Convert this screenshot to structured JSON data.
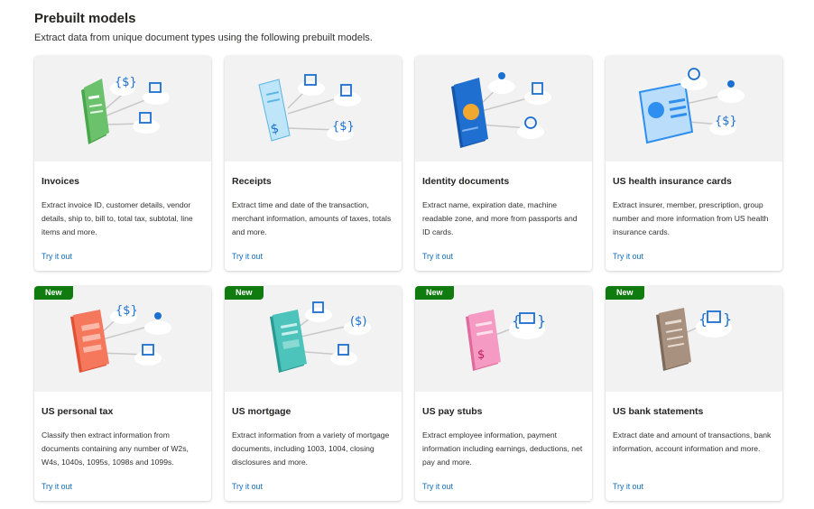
{
  "header": {
    "title": "Prebuilt models",
    "subtitle": "Extract data from unique document types using the following prebuilt models."
  },
  "badge_label": "New",
  "colors": {
    "link": "#0f6cbd",
    "badge": "#107c10",
    "card_image_bg": "#f2f2f2",
    "invoice": "#5bb85b",
    "receipt": "#a8dcf5",
    "identity": "#1a6fd1",
    "health": "#2f8ff0",
    "tax": "#f0674a",
    "mortgage": "#3cb8b0",
    "paystub": "#f088b4",
    "bank": "#9a8676"
  },
  "cards": [
    {
      "title": "Invoices",
      "description": "Extract invoice ID, customer details, vendor details, ship to, bill to, total tax, subtotal, line items and more.",
      "link": "Try it out",
      "icon": "invoice-document-icon",
      "is_new": false
    },
    {
      "title": "Receipts",
      "description": "Extract time and date of the transaction, merchant information, amounts of taxes, totals and more.",
      "link": "Try it out",
      "icon": "receipt-document-icon",
      "is_new": false
    },
    {
      "title": "Identity documents",
      "description": "Extract name, expiration date, machine readable zone, and more from passports and ID cards.",
      "link": "Try it out",
      "icon": "passport-icon",
      "is_new": false
    },
    {
      "title": "US health insurance cards",
      "description": "Extract insurer, member, prescription, group number and more information from US health insurance cards.",
      "link": "Try it out",
      "icon": "health-card-icon",
      "is_new": false
    },
    {
      "title": "US personal tax",
      "description": "Classify then extract information from documents containing any number of W2s, W4s, 1040s, 1095s, 1098s and 1099s.",
      "link": "Try it out",
      "icon": "tax-form-icon",
      "is_new": true
    },
    {
      "title": "US mortgage",
      "description": "Extract information from a variety of mortgage documents, including 1003, 1004, closing disclosures and more.",
      "link": "Try it out",
      "icon": "mortgage-document-icon",
      "is_new": true
    },
    {
      "title": "US pay stubs",
      "description": "Extract employee information, payment information including earnings, deductions, net pay and more.",
      "link": "Try it out",
      "icon": "pay-stub-icon",
      "is_new": true
    },
    {
      "title": "US bank statements",
      "description": "Extract date and amount of transactions, bank information, account information and more.",
      "link": "Try it out",
      "icon": "bank-statement-icon",
      "is_new": true
    }
  ]
}
